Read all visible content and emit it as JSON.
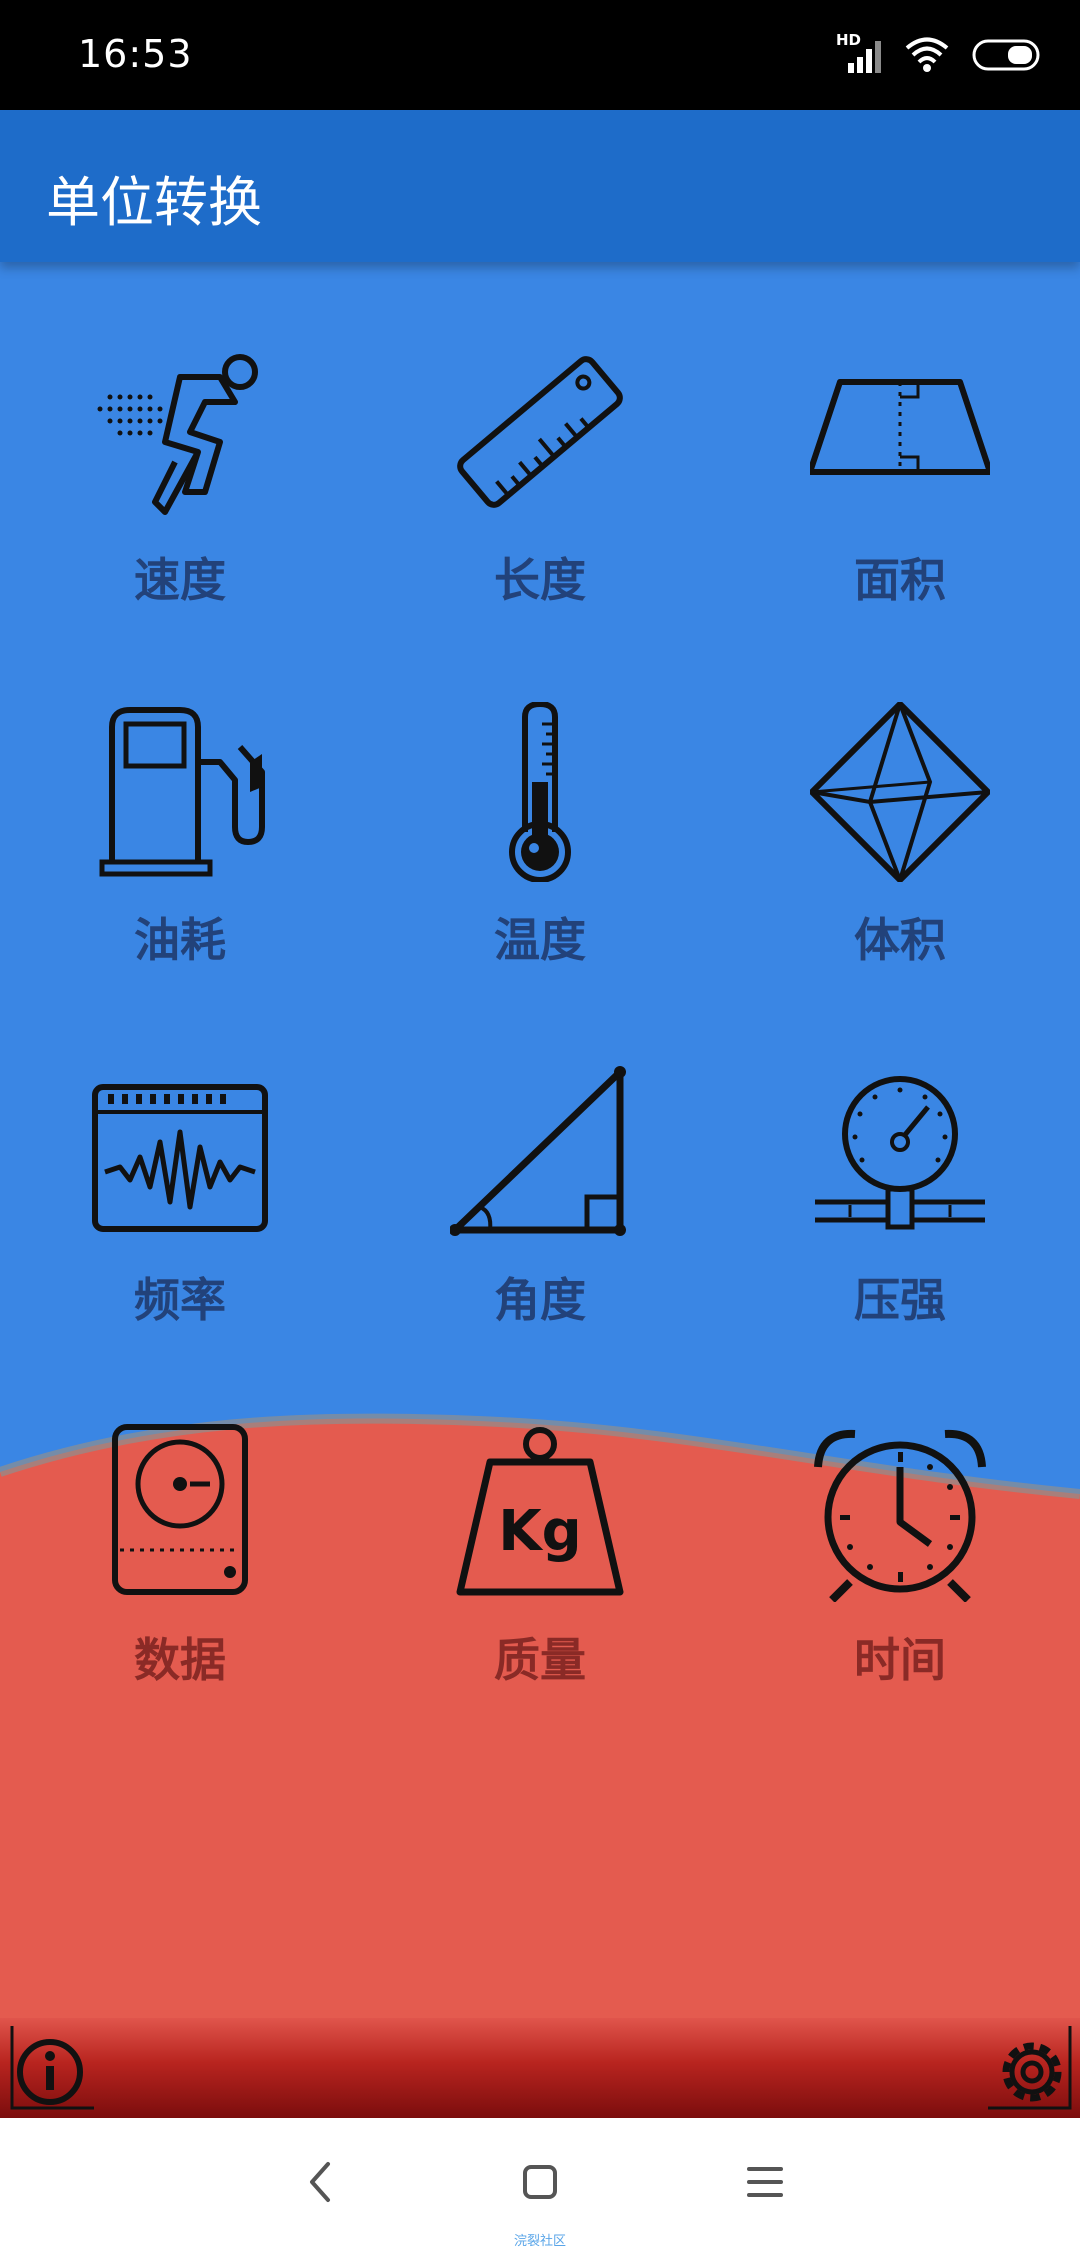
{
  "status_bar": {
    "time": "16:53",
    "icons": [
      "hd-signal-icon",
      "wifi-icon",
      "battery-icon"
    ],
    "hd_label": "HD"
  },
  "app_bar": {
    "title": "单位转换"
  },
  "grid": {
    "items": [
      {
        "label": "速度",
        "icon": "runner-icon"
      },
      {
        "label": "长度",
        "icon": "ruler-icon"
      },
      {
        "label": "面积",
        "icon": "trapezoid-area-icon"
      },
      {
        "label": "油耗",
        "icon": "fuel-pump-icon"
      },
      {
        "label": "温度",
        "icon": "thermometer-icon"
      },
      {
        "label": "体积",
        "icon": "octahedron-icon"
      },
      {
        "label": "频率",
        "icon": "waveform-icon"
      },
      {
        "label": "角度",
        "icon": "right-triangle-icon"
      },
      {
        "label": "压强",
        "icon": "pressure-gauge-icon"
      },
      {
        "label": "数据",
        "icon": "hard-drive-icon"
      },
      {
        "label": "质量",
        "icon": "kg-weight-icon"
      },
      {
        "label": "时间",
        "icon": "alarm-clock-icon"
      }
    ],
    "weight_text": "Kg"
  },
  "bottom_bar": {
    "info_icon": "info-icon",
    "settings_icon": "gear-icon"
  },
  "nav_bar": {
    "icons": [
      "back-icon",
      "home-icon",
      "menu-icon"
    ],
    "watermark": "浣裂社区"
  },
  "colors": {
    "status_bar": "#000000",
    "app_bar": "#1e6cc9",
    "content_blue": "#3a86e4",
    "content_red": "#e45b4f",
    "label_blue": "#22427a",
    "label_red": "#8a2a26",
    "bottom_bar": "#b8241f"
  }
}
